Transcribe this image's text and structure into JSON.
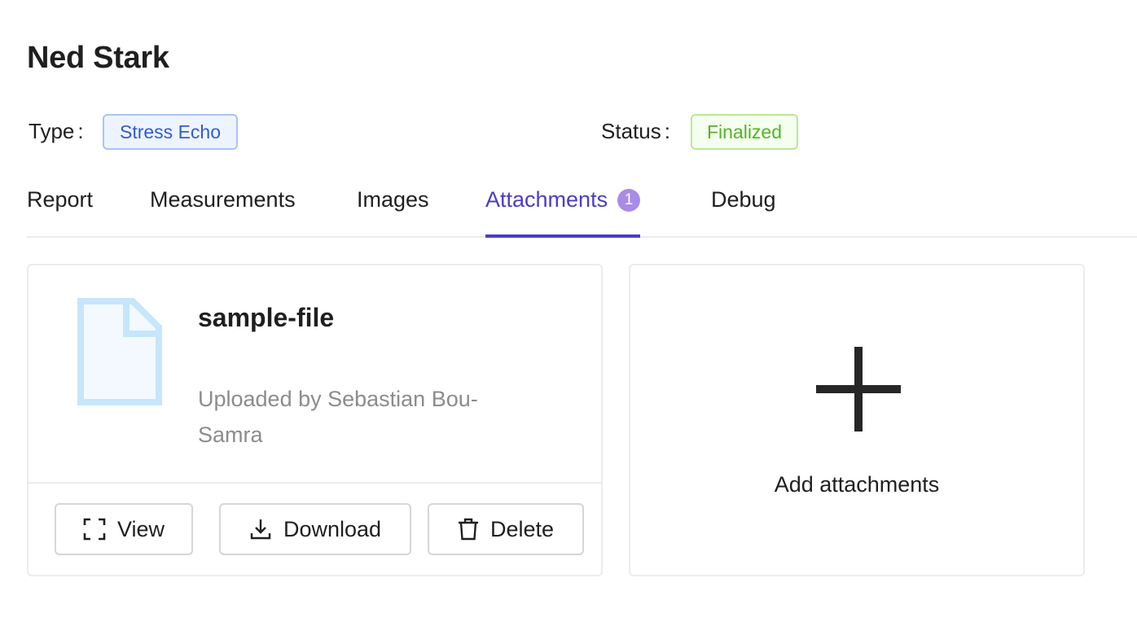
{
  "header": {
    "title": "Ned Stark"
  },
  "meta": {
    "type_label": "Type",
    "type_value": "Stress Echo",
    "status_label": "Status",
    "status_value": "Finalized"
  },
  "tabs": [
    {
      "label": "Report"
    },
    {
      "label": "Measurements"
    },
    {
      "label": "Images"
    },
    {
      "label": "Attachments",
      "badge": "1",
      "active": true
    },
    {
      "label": "Debug"
    }
  ],
  "attachment": {
    "name": "sample-file",
    "uploader": "Uploaded by Sebastian Bou-Samra",
    "icon": "file-icon",
    "actions": {
      "view_label": "View",
      "download_label": "Download",
      "delete_label": "Delete"
    }
  },
  "add_attachment": {
    "label": "Add attachments",
    "icon": "plus-icon"
  },
  "colors": {
    "accent": "#4b3cc9",
    "badge": "#a98be6",
    "type_tag": "#2f5cd6",
    "status_tag": "#52b427"
  }
}
